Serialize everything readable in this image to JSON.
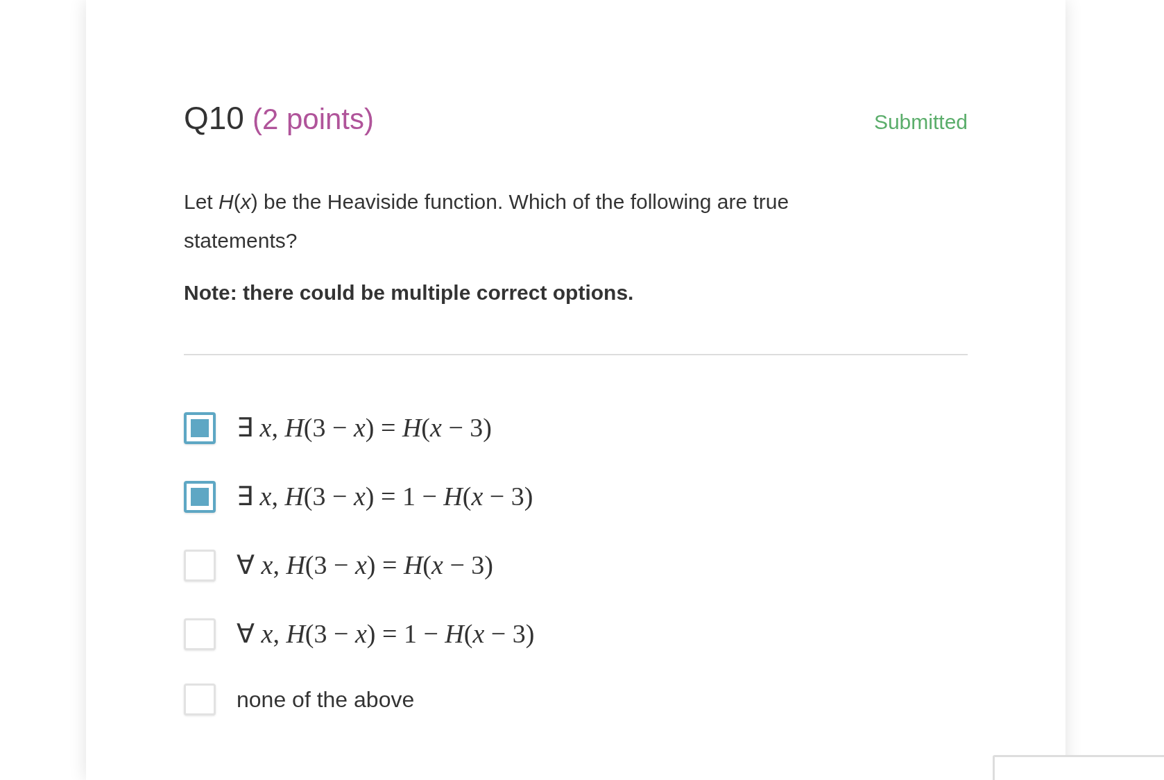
{
  "question": {
    "number": "Q10",
    "points": "(2 points)",
    "status": "Submitted",
    "prompt": "Let *H*(*x*) be the Heaviside function. Which of the following are true statements?",
    "note": "Note: there could be multiple correct options.",
    "options": [
      {
        "kind": "math",
        "label": "∃ *x*, *H*(3 − *x*) = *H*(*x* − 3)",
        "checked": true
      },
      {
        "kind": "math",
        "label": "∃ *x*, *H*(3 − *x*) = 1 − *H*(*x* − 3)",
        "checked": true
      },
      {
        "kind": "math",
        "label": "∀ *x*, *H*(3 − *x*) = *H*(*x* − 3)",
        "checked": false
      },
      {
        "kind": "math",
        "label": "∀ *x*, *H*(3 − *x*) = 1 − *H*(*x* − 3)",
        "checked": false
      },
      {
        "kind": "text",
        "label": "none of the above",
        "checked": false
      }
    ]
  }
}
